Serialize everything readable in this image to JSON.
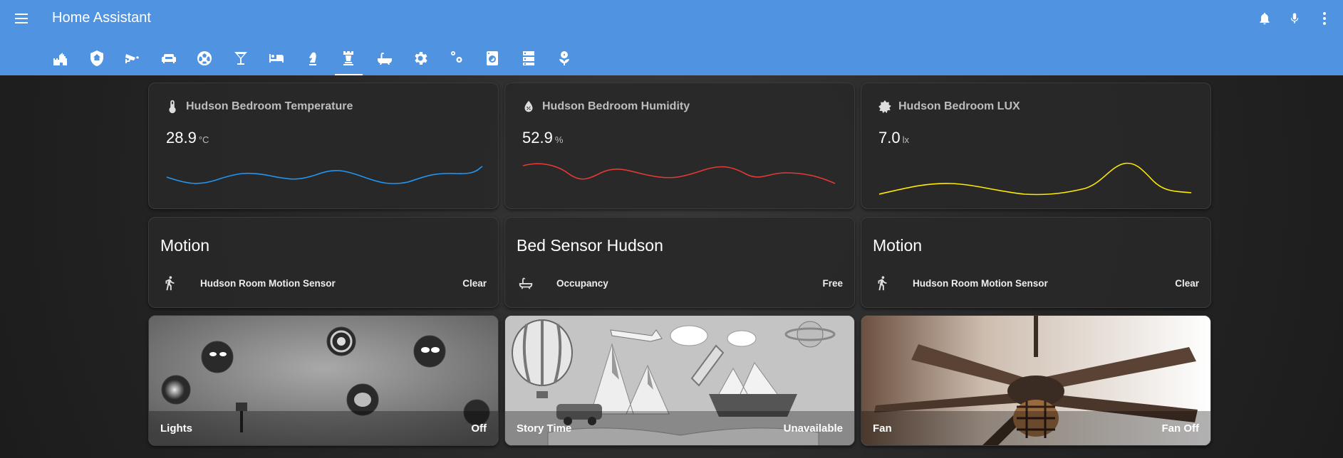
{
  "app": {
    "title": "Home Assistant"
  },
  "top_actions": [
    "bell-icon",
    "microphone-icon",
    "more-vertical-icon"
  ],
  "tabs": [
    "castle-icon",
    "shield-home-icon",
    "cctv-icon",
    "sofa-icon",
    "soccer-icon",
    "glass-cocktail-icon",
    "bed-icon",
    "chess-knight-icon",
    "chess-rook-icon",
    "bathtub-icon",
    "cog-icon",
    "cogs-icon",
    "washing-machine-icon",
    "server-icon",
    "sprout-icon"
  ],
  "active_tab": 8,
  "sensors": [
    {
      "name": "Hudson Bedroom Temperature",
      "value": "28.9",
      "unit": "°C",
      "icon": "thermometer-icon",
      "color": "#2196f3"
    },
    {
      "name": "Hudson Bedroom Humidity",
      "value": "52.9",
      "unit": "%",
      "icon": "water-percent-icon",
      "color": "#e53935"
    },
    {
      "name": "Hudson Bedroom LUX",
      "value": "7.0",
      "unit": "lx",
      "icon": "brightness-icon",
      "color": "#ffeb00"
    }
  ],
  "entity_cards": [
    {
      "title": "Motion",
      "entity": "Hudson Room Motion Sensor",
      "state": "Clear",
      "icon": "walk-icon"
    },
    {
      "title": "Bed Sensor Hudson",
      "entity": "Occupancy",
      "state": "Free",
      "icon": "bathtub-icon"
    },
    {
      "title": "Motion",
      "entity": "Hudson Room Motion Sensor",
      "state": "Clear",
      "icon": "walk-icon"
    }
  ],
  "picture_cards": [
    {
      "name": "Lights",
      "state": "Off"
    },
    {
      "name": "Story Time",
      "state": "Unavailable"
    },
    {
      "name": "Fan",
      "state": "Fan Off"
    }
  ]
}
